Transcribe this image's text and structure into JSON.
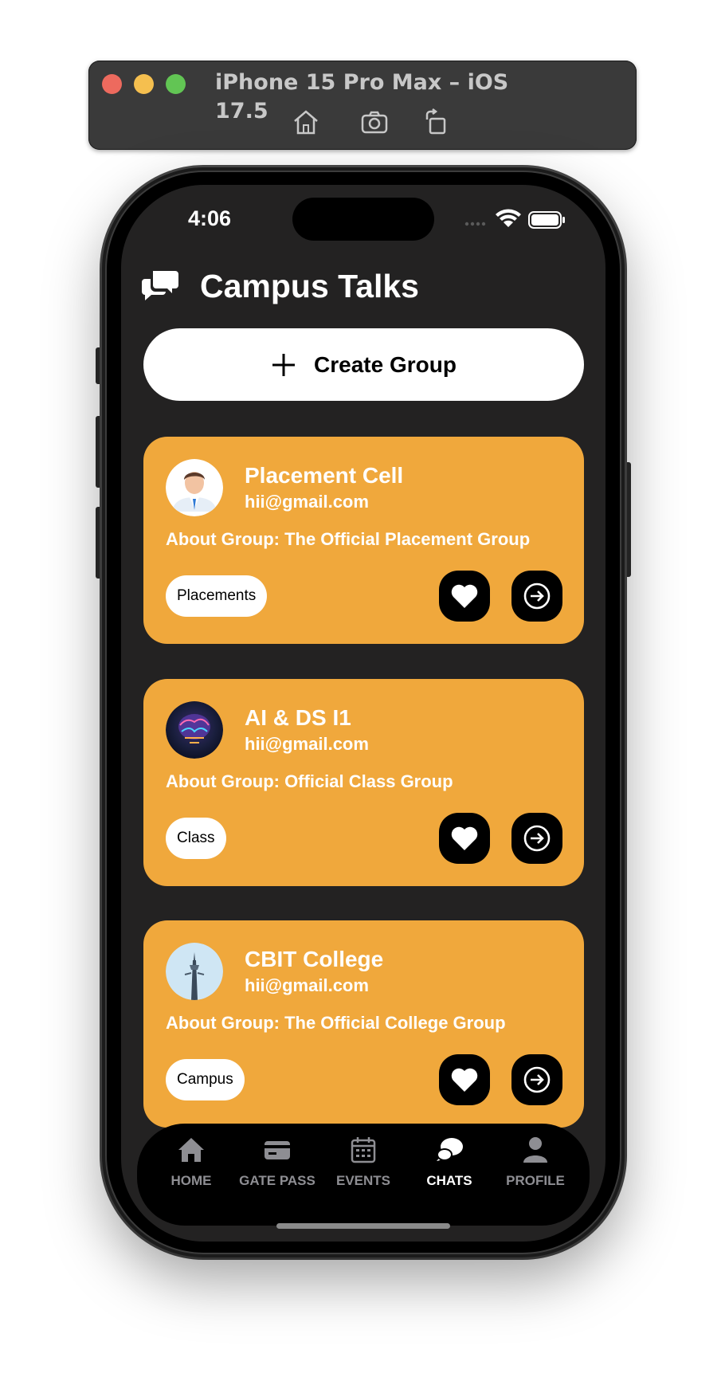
{
  "simulator": {
    "title": "iPhone 15 Pro Max – iOS 17.5",
    "buttons": [
      "home-icon",
      "camera-icon",
      "rotate-icon"
    ],
    "traffic_lights": {
      "close": "#ed6a5e",
      "minimize": "#f5bf4f",
      "zoom": "#62c554"
    }
  },
  "status_bar": {
    "time": "4:06"
  },
  "app": {
    "title": "Campus Talks",
    "title_icon": "chat-bubbles-icon",
    "create_group_label": "Create Group"
  },
  "groups": [
    {
      "name": "Placement Cell",
      "email": "hii@gmail.com",
      "about": "About Group: The Official Placement Group",
      "tag": "Placements",
      "avatar": "person-avatar"
    },
    {
      "name": "AI & DS I1",
      "email": "hii@gmail.com",
      "about": "About Group: Official Class Group",
      "tag": "Class",
      "avatar": "ai-brain-avatar"
    },
    {
      "name": "CBIT College",
      "email": "hii@gmail.com",
      "about": "About Group: The Official College Group",
      "tag": "Campus",
      "avatar": "college-tower-avatar"
    }
  ],
  "tabs": [
    {
      "label": "HOME",
      "icon": "home-icon",
      "active": false
    },
    {
      "label": "GATE PASS",
      "icon": "card-icon",
      "active": false
    },
    {
      "label": "EVENTS",
      "icon": "calendar-icon",
      "active": false
    },
    {
      "label": "CHATS",
      "icon": "chat-icon",
      "active": true
    },
    {
      "label": "PROFILE",
      "icon": "person-icon",
      "active": false
    }
  ],
  "colors": {
    "card": "#f0a83c",
    "screen_bg": "#232222",
    "tab_active": "#ffffff",
    "tab_inactive": "#8e8e93"
  }
}
